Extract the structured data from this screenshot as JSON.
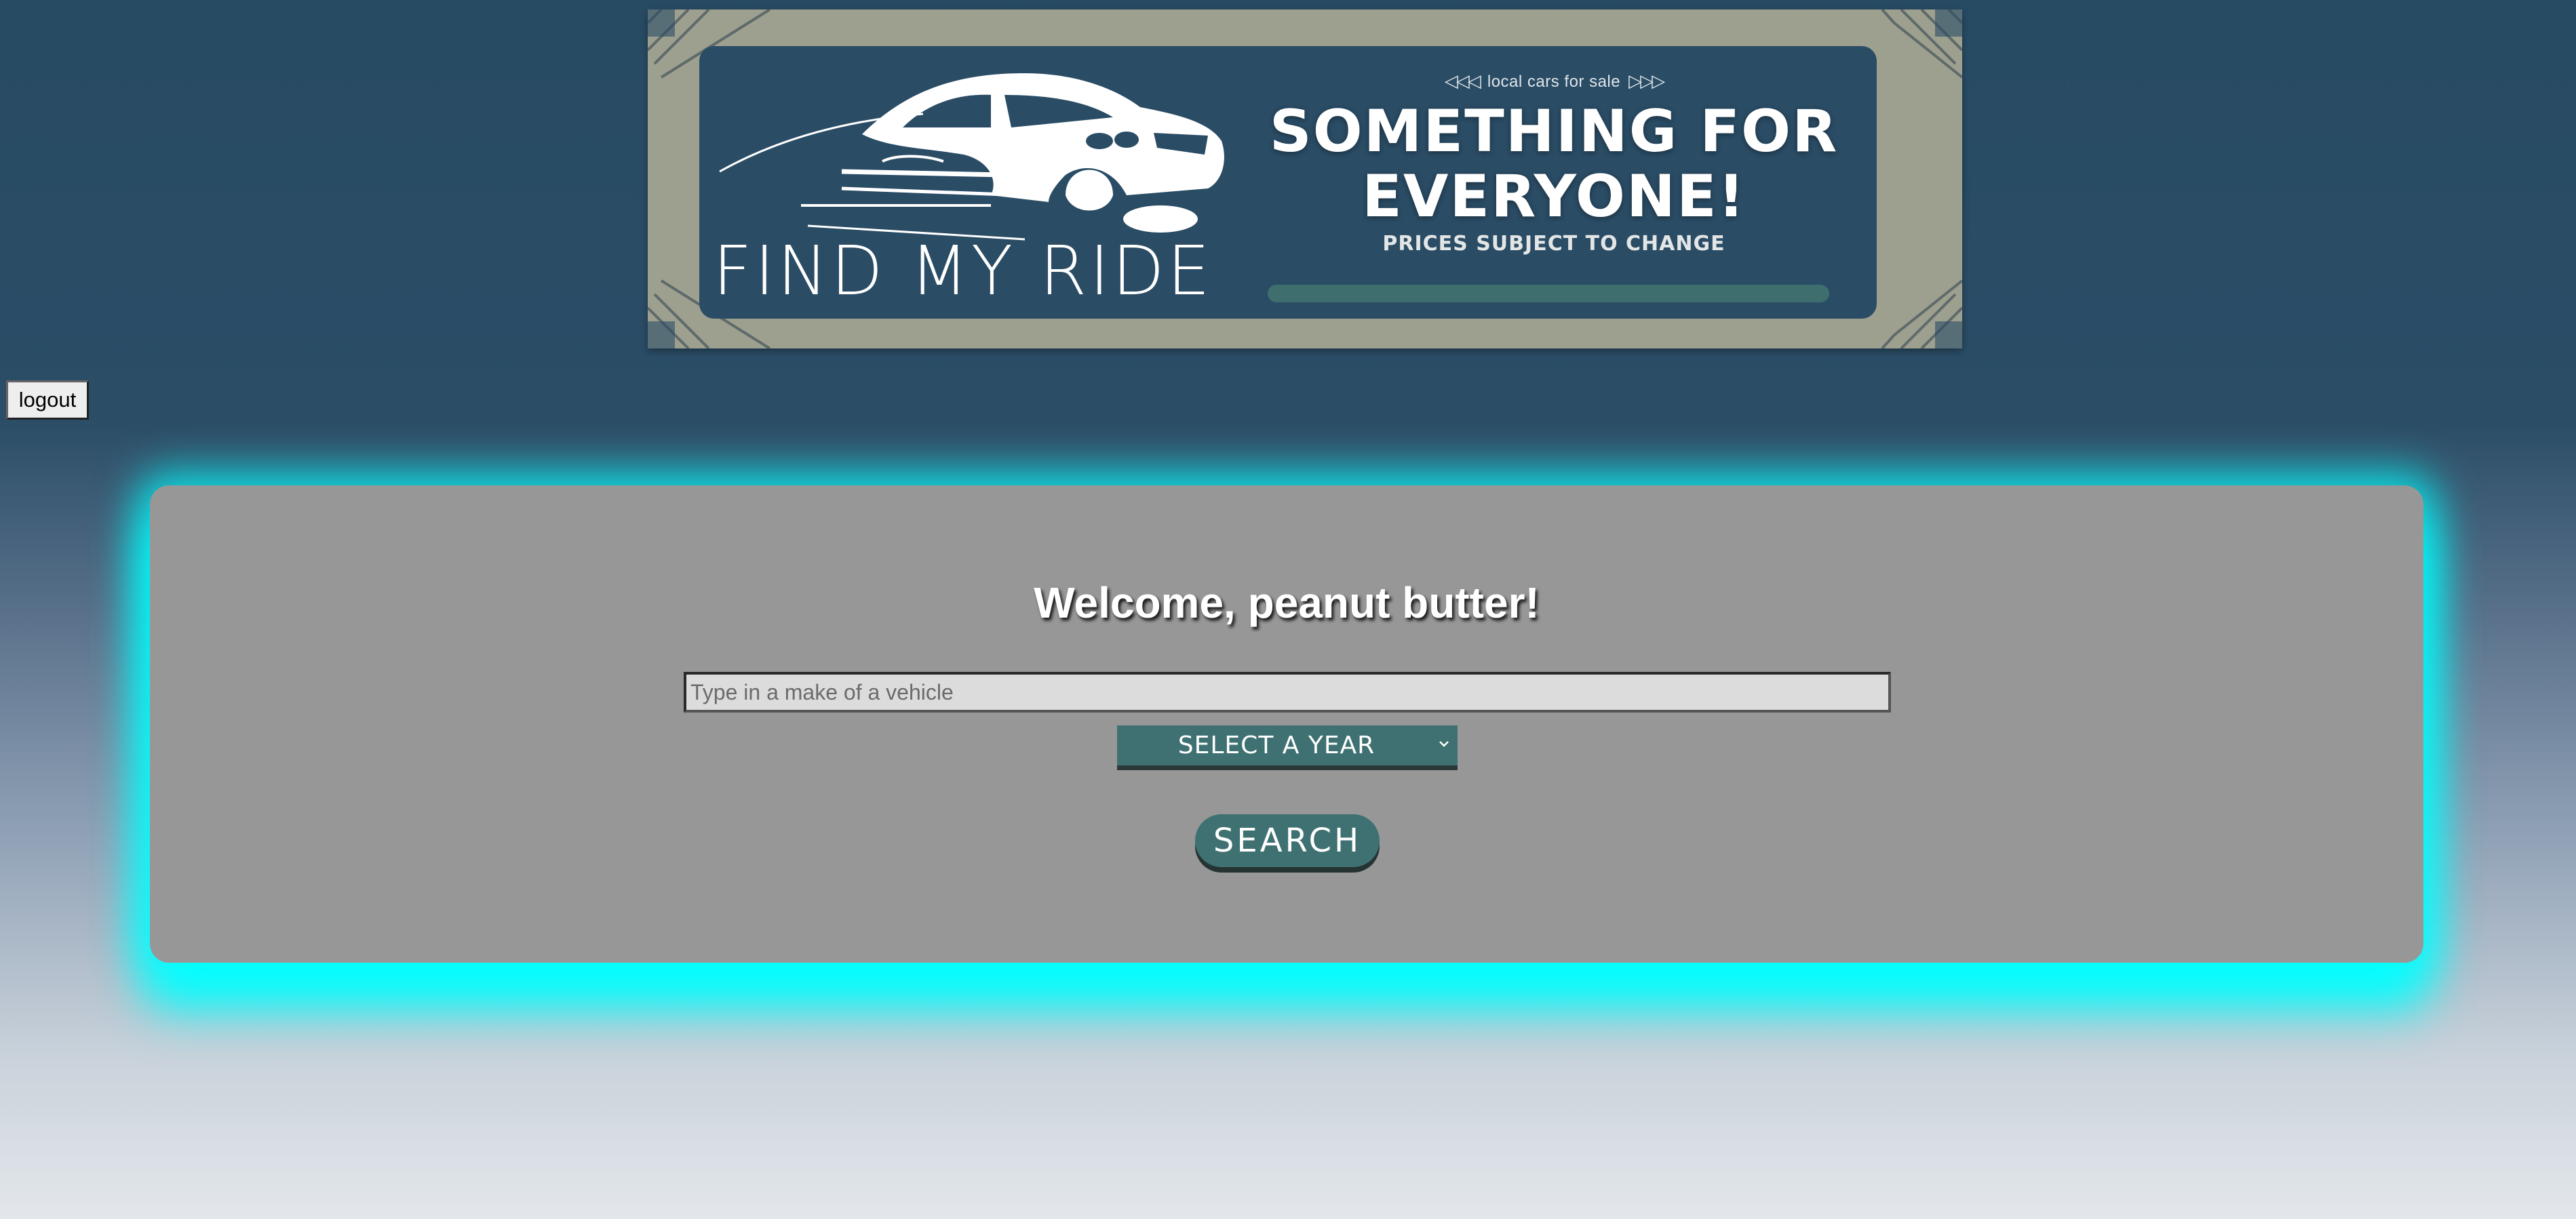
{
  "banner": {
    "brand": "FIND MY RIDE",
    "tagline_small": "local cars for sale",
    "arrows_left": "◁◁◁",
    "arrows_right": "▷▷▷",
    "headline_line1": "SOMETHING FOR",
    "headline_line2": "EVERYONE!",
    "subheadline": "PRICES SUBJECT TO CHANGE"
  },
  "header": {
    "logout_label": "logout"
  },
  "main": {
    "welcome": "Welcome, peanut butter!",
    "make_input": {
      "value": "",
      "placeholder": "Type in a make of a vehicle"
    },
    "year_select": {
      "selected": "SELECT A YEAR"
    },
    "search_label": "SEARCH"
  },
  "colors": {
    "page_top": "#284b64",
    "page_bottom": "#e3e7eb",
    "banner_frame": "#9da08f",
    "banner_inner": "#2a4c65",
    "card": "#979797",
    "card_glow": "#00ffff",
    "accent_teal": "#3f7172"
  },
  "icons": {
    "car": "car-silhouette-icon",
    "chevron": "chevron-down-icon"
  }
}
